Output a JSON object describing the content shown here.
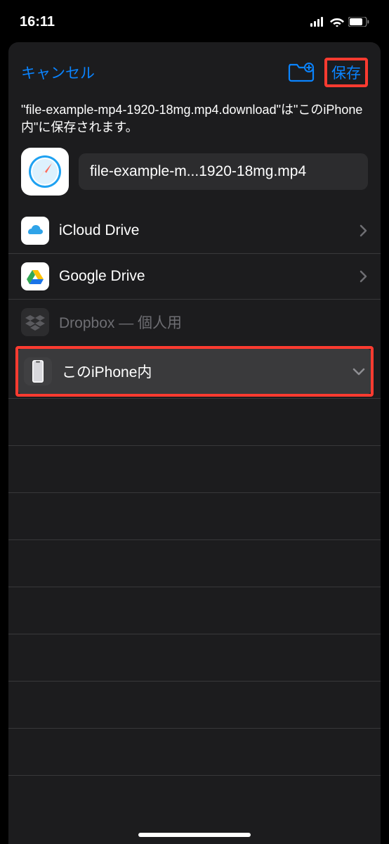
{
  "status": {
    "time": "16:11"
  },
  "nav": {
    "cancel": "キャンセル",
    "save": "保存"
  },
  "description": "\"file-example-mp4-1920-18mg.mp4.download\"は\"このiPhone内\"に保存されます。",
  "file": {
    "filename": "file-example-m...1920-18mg.mp4"
  },
  "locations": {
    "icloud": "iCloud Drive",
    "gdrive": "Google Drive",
    "dropbox": "Dropbox — 個人用",
    "iphone": "このiPhone内"
  }
}
